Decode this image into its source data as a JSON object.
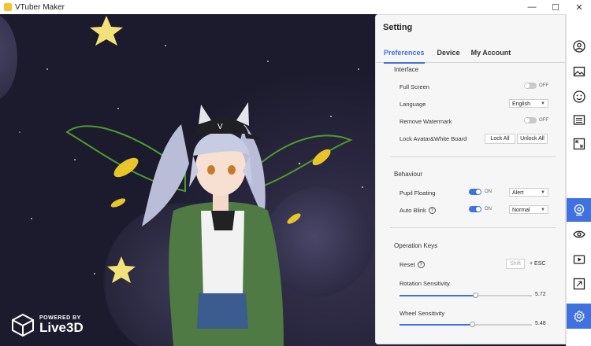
{
  "app": {
    "title": "VTuber Maker"
  },
  "window_controls": {
    "minimize": "—",
    "maximize": "☐",
    "close": "✕"
  },
  "branding": {
    "powered_line": "POWERED BY",
    "brand": "Live3D"
  },
  "panel": {
    "title": "Setting",
    "tabs": [
      {
        "label": "Preferences",
        "active": true
      },
      {
        "label": "Device",
        "active": false
      },
      {
        "label": "My Account",
        "active": false
      }
    ],
    "interface": {
      "title": "Interface",
      "full_screen": {
        "label": "Full Screen",
        "state": "OFF"
      },
      "language": {
        "label": "Language",
        "value": "English"
      },
      "remove_watermark": {
        "label": "Remove Watermark",
        "state": "OFF"
      },
      "lock": {
        "label": "Lock Avatar&White Board",
        "lock_all": "Lock All",
        "unlock_all": "Unlock All"
      }
    },
    "behaviour": {
      "title": "Behaviour",
      "pupil_floating": {
        "label": "Pupil Floating",
        "state": "ON",
        "option": "Alert"
      },
      "auto_blink": {
        "label": "Auto Blink",
        "help": "?",
        "state": "ON",
        "option": "Normal"
      }
    },
    "operation_keys": {
      "title": "Operation Keys",
      "reset": {
        "label": "Reset",
        "help": "?",
        "key_placeholder": "Shift",
        "suffix": "+ ESC"
      },
      "rotation": {
        "label": "Rotation Sensitivity",
        "value": "5.72",
        "fraction": 0.57
      },
      "wheel": {
        "label": "Wheel Sensitivity",
        "value": "5.48",
        "fraction": 0.55
      }
    }
  },
  "colors": {
    "accent": "#3f71e0",
    "background": "#1c1b2d",
    "panel": "#f6f6f6"
  },
  "sidebar": {
    "items": [
      {
        "icon": "user-icon",
        "active": false
      },
      {
        "icon": "image-icon",
        "active": false
      },
      {
        "icon": "face-icon",
        "active": false
      },
      {
        "icon": "whiteboard-icon",
        "active": false
      },
      {
        "icon": "fullscreen-icon",
        "active": false
      },
      {
        "icon": "webcam-icon",
        "active": false
      },
      {
        "icon": "eye-icon",
        "active": false
      },
      {
        "icon": "stream-icon",
        "active": false
      },
      {
        "icon": "picture-in-picture-icon",
        "active": false
      },
      {
        "icon": "gear-icon",
        "active": true
      }
    ]
  }
}
